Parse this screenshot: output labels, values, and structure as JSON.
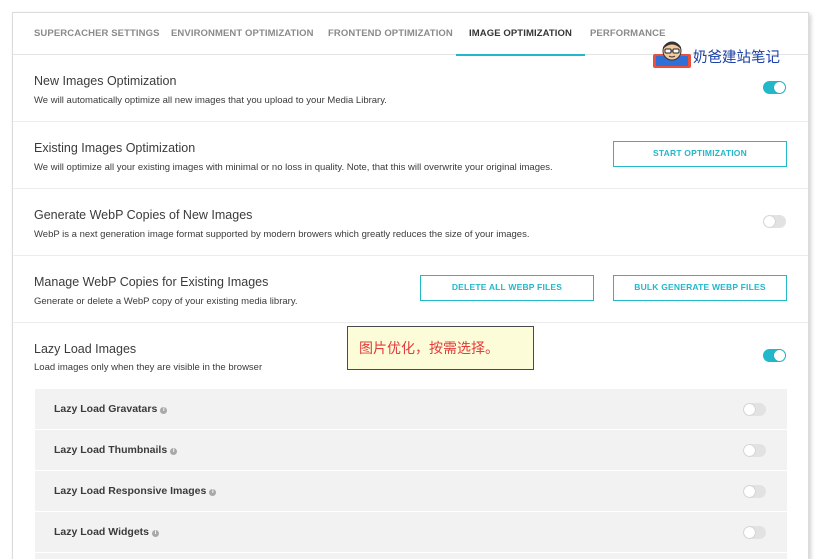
{
  "tabs": [
    {
      "label": "SUPERCACHER SETTINGS",
      "active": false
    },
    {
      "label": "ENVIRONMENT OPTIMIZATION",
      "active": false
    },
    {
      "label": "FRONTEND OPTIMIZATION",
      "active": false
    },
    {
      "label": "IMAGE OPTIMIZATION",
      "active": true
    },
    {
      "label": "PERFORMANCE",
      "active": false
    }
  ],
  "rows": {
    "new_images": {
      "title": "New Images Optimization",
      "desc": "We will automatically optimize all new images that you upload to your Media Library.",
      "toggle_on": true
    },
    "existing_images": {
      "title": "Existing Images Optimization",
      "desc": "We will optimize all your existing images with minimal or no loss in quality. Note, that this will overwrite your original images.",
      "button": "START OPTIMIZATION"
    },
    "webp_new": {
      "title": "Generate WebP Copies of New Images",
      "desc": "WebP is a next generation image format supported by modern browers which greatly reduces the size of your images.",
      "toggle_on": false
    },
    "webp_manage": {
      "title": "Manage WebP Copies for Existing Images",
      "desc": "Generate or delete a WebP copy of your existing media library.",
      "delete_button": "DELETE ALL WEBP FILES",
      "bulk_button": "BULK GENERATE WEBP FILES"
    },
    "lazy_load": {
      "title": "Lazy Load Images",
      "desc": "Load images only when they are visible in the browser",
      "toggle_on": true
    }
  },
  "lazy_sub": [
    {
      "label": "Lazy Load Gravatars",
      "toggle_on": false
    },
    {
      "label": "Lazy Load Thumbnails",
      "toggle_on": false
    },
    {
      "label": "Lazy Load Responsive Images",
      "toggle_on": false
    },
    {
      "label": "Lazy Load Widgets",
      "toggle_on": false
    }
  ],
  "info_glyph": "i",
  "annotation": "图片优化，按需选择。",
  "watermark": {
    "text": "奶爸建站笔记",
    "icon": "avatar-logo"
  },
  "colors": {
    "accent": "#22b8c9",
    "annotation_text": "#e23b3b",
    "annotation_bg": "#fdfcd8",
    "watermark_text": "#1a3fa6"
  }
}
